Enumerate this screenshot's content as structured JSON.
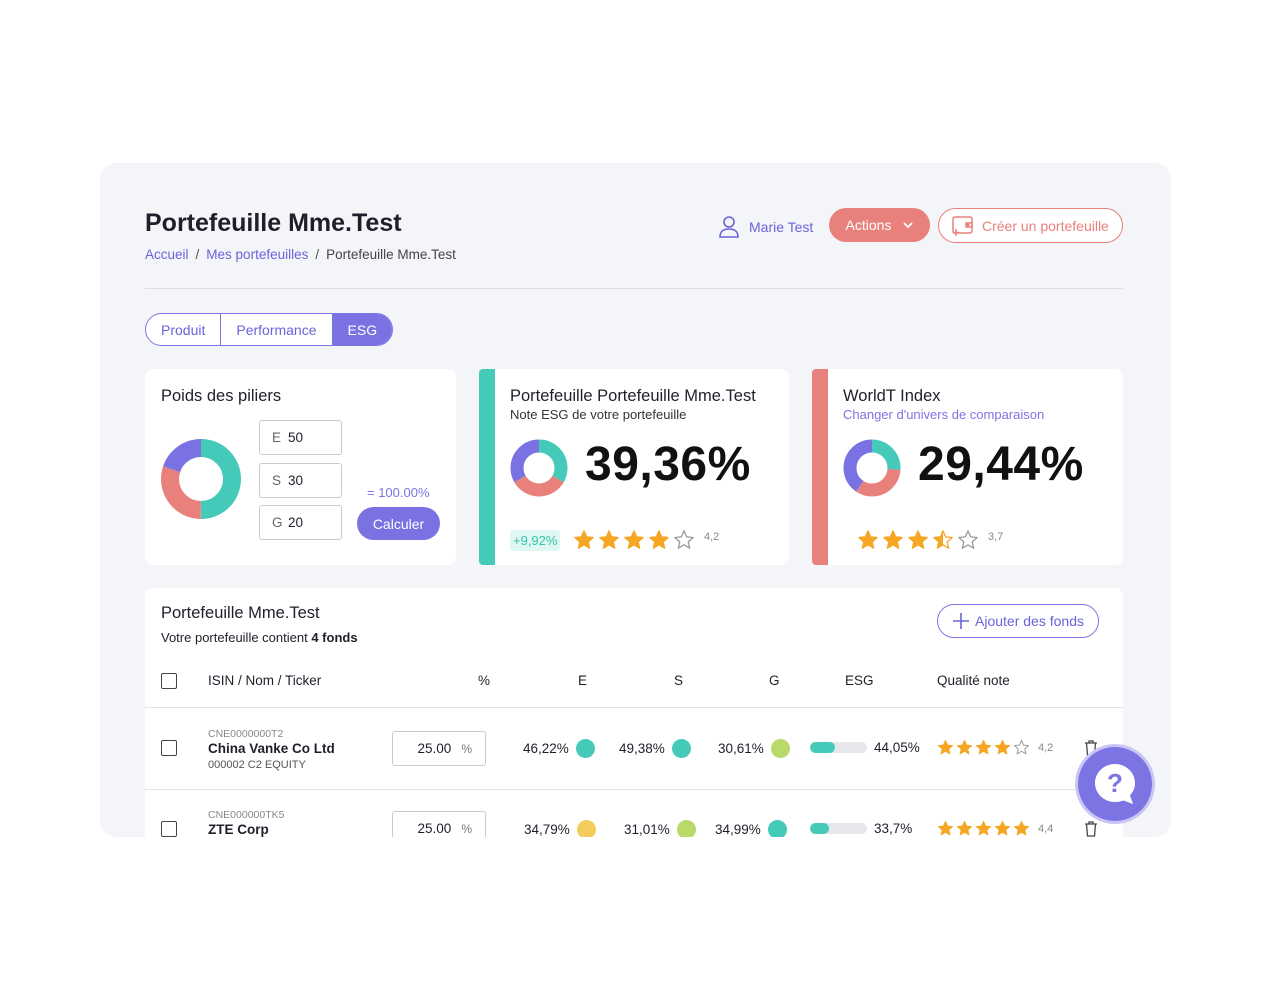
{
  "header": {
    "title": "Portefeuille Mme.Test",
    "breadcrumb": [
      "Accueil",
      "Mes portefeuilles",
      "Portefeuille Mme.Test"
    ],
    "user_name": "Marie Test",
    "actions_label": "Actions",
    "create_label": "Créer un portefeuille"
  },
  "tabs": [
    {
      "label": "Produit",
      "active": false
    },
    {
      "label": "Performance",
      "active": false
    },
    {
      "label": "ESG",
      "active": true
    }
  ],
  "pillars": {
    "title": "Poids des piliers",
    "inputs": [
      {
        "label": "E",
        "value": "50"
      },
      {
        "label": "S",
        "value": "30"
      },
      {
        "label": "G",
        "value": "20"
      }
    ],
    "total": "= 100.00%",
    "calc_label": "Calculer"
  },
  "portfolio_score": {
    "title": "Portefeuille Portefeuille Mme.Test",
    "subtitle": "Note ESG de votre portefeuille",
    "value": "39,36%",
    "delta": "+9,92%",
    "rating": 4.2,
    "rating_label": "4,2",
    "accent": "#45c9b8"
  },
  "index_score": {
    "title": "WorldT Index",
    "link": "Changer d'univers de comparaison",
    "value": "29,44%",
    "rating": 3.7,
    "rating_label": "3,7",
    "accent": "#e8817b"
  },
  "funds": {
    "title": "Portefeuille Mme.Test",
    "subtitle_prefix": "Votre portefeuille contient ",
    "subtitle_count": "4 fonds",
    "add_label": "Ajouter des fonds",
    "columns": [
      "ISIN / Nom / Ticker",
      "%",
      "E",
      "S",
      "G",
      "ESG",
      "Qualité note"
    ],
    "rows": [
      {
        "isin": "CNE0000000T2",
        "name": "China Vanke Co Ltd",
        "ticker": "000002 C2 EQUITY",
        "weight": "25.00",
        "unit": "%",
        "e": "46,22%",
        "e_color": "#45c9b8",
        "s": "49,38%",
        "s_color": "#45c9b8",
        "g": "30,61%",
        "g_color": "#b9d96a",
        "esg": "44,05%",
        "esg_level": 0.44,
        "rating": 4.2,
        "rating_label": "4,2"
      },
      {
        "isin": "CNE000000TK5",
        "name": "ZTE Corp",
        "ticker": "",
        "weight": "25.00",
        "unit": "%",
        "e": "34,79%",
        "e_color": "#f2cd5c",
        "s": "31,01%",
        "s_color": "#b9d96a",
        "g": "34,99%",
        "g_color": "#45c9b8",
        "esg": "33,7%",
        "esg_level": 0.337,
        "rating": 4.4,
        "rating_label": "4,4"
      }
    ]
  }
}
